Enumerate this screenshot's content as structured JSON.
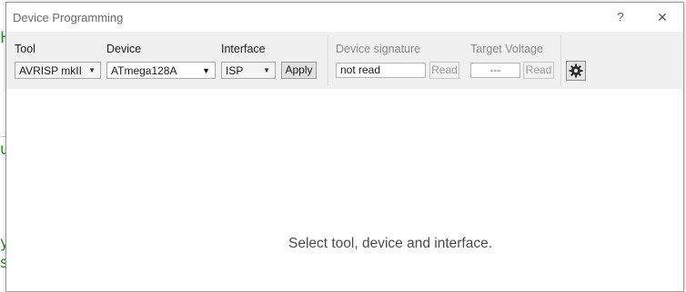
{
  "window": {
    "title": "Device Programming",
    "help_label": "?",
    "close_label": "✕"
  },
  "toolbar": {
    "tool": {
      "label": "Tool",
      "value": "AVRISP mkII"
    },
    "device": {
      "label": "Device",
      "value": "ATmega128A"
    },
    "interface": {
      "label": "Interface",
      "value": "ISP"
    },
    "apply_label": "Apply",
    "signature": {
      "label": "Device signature",
      "value": "not read",
      "read_label": "Read"
    },
    "voltage": {
      "label": "Target Voltage",
      "value": "---",
      "read_label": "Read"
    },
    "settings_icon": "gear-icon"
  },
  "content": {
    "hint": "Select tool, device and interface."
  },
  "background": {
    "glyphs": [
      "H",
      "u",
      "y",
      "s"
    ]
  },
  "colors": {
    "toolbar_bg": "#f0f0f0",
    "background_text": "#2e8b2e"
  }
}
